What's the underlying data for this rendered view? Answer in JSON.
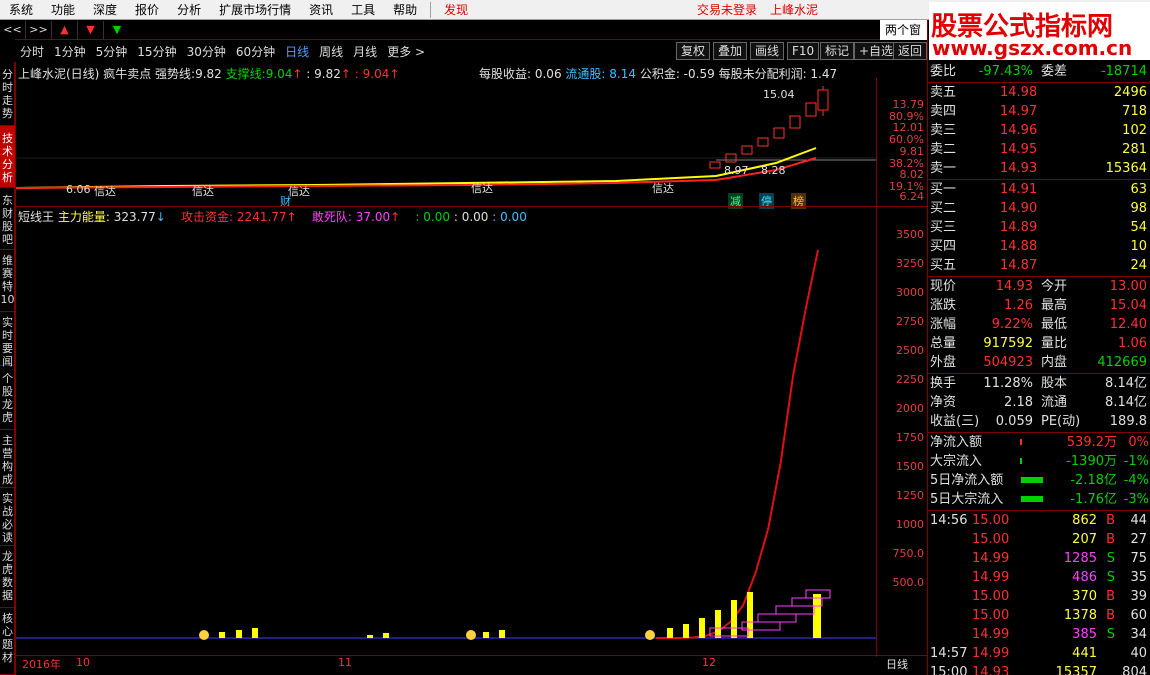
{
  "menu": {
    "items": [
      "系统",
      "功能",
      "深度",
      "报价",
      "分析",
      "扩展市场行情",
      "资讯",
      "工具",
      "帮助"
    ],
    "discover": "发现",
    "status": "交易未登录",
    "stock_name": "上峰水泥"
  },
  "nav": {
    "back": "<<",
    "fwd": ">>",
    "up": "▲",
    "down": "▼",
    "dd": "▼"
  },
  "periods": [
    "分时",
    "1分钟",
    "5分钟",
    "15分钟",
    "30分钟",
    "60分钟",
    "日线",
    "周线",
    "月线",
    "更多 >"
  ],
  "tools": [
    "复权",
    "叠加",
    "画线",
    "F10",
    "标记",
    "+自选",
    "返回"
  ],
  "window_tab": "两个窗",
  "left_tabs": [
    "分时走势",
    "技术分析",
    "东财股吧",
    "维赛特10",
    "实时要闻",
    "个股龙虎",
    "主营构成",
    "实战必读",
    "龙虎数据",
    "核心题材"
  ],
  "upper_legend": {
    "name": "上峰水泥(日线)",
    "indicator": "疯牛卖点",
    "strong_label": "强势线:",
    "strong_val": "9.82",
    "support_label": "支撑线:",
    "support_val": "9.04",
    "v3": ": 9.82",
    "v4": ": 9.04",
    "eps": "每股收益: 0.06",
    "float": "流通股: 8.14",
    "reserve": "公积金: -0.59",
    "undist": "每股未分配利润: 1.47"
  },
  "lower_legend": {
    "name": "短线王",
    "main_label": "主力能量:",
    "main_val": "323.77",
    "attack_label": "攻击资金:",
    "attack_val": "2241.77",
    "dare_label": "敢死队:",
    "dare_val": "37.00",
    "v4": ": 0.00",
    "v5": ": 0.00",
    "v6": ": 0.00"
  },
  "upper_axis": [
    "13.79",
    "80.9%",
    "12.01",
    "60.0%",
    "9.81",
    "38.2%",
    "8.02",
    "19.1%",
    "6.24"
  ],
  "upper_marks": {
    "high": "15.04",
    "p1": "8.97",
    "p2": "8.28",
    "low": "6.06"
  },
  "upper_labels": [
    "信达",
    "信达",
    "信达",
    "信达",
    "信达"
  ],
  "badges": [
    "财",
    "减",
    "停",
    "榜"
  ],
  "lower_axis": [
    "3500",
    "3250",
    "3000",
    "2750",
    "2500",
    "2250",
    "2000",
    "1750",
    "1500",
    "1250",
    "1000",
    "750.0",
    "500.0"
  ],
  "x_axis": {
    "year": "2016年",
    "m10": "10",
    "m11": "11",
    "m12": "12",
    "period": "日线"
  },
  "chart_data": {
    "type": "line",
    "series": [
      {
        "name": "攻击资金",
        "values": [
          0,
          0,
          0,
          5,
          20,
          60,
          150,
          300,
          600,
          1000,
          1600,
          2400,
          3000,
          3550
        ]
      },
      {
        "name": "主力能量",
        "values": [
          0,
          0,
          0,
          0,
          10,
          30,
          60,
          120,
          200,
          323.77
        ]
      }
    ]
  },
  "logo": {
    "line1": "股票公式指标网",
    "line2": "www.gszx.com.cn"
  },
  "quote": {
    "weibi_label": "委比",
    "weibi_val": "-97.43%",
    "weicha_label": "委差",
    "weicha_val": "-18714",
    "asks": [
      {
        "label": "卖五",
        "price": "14.98",
        "vol": "2496"
      },
      {
        "label": "卖四",
        "price": "14.97",
        "vol": "718"
      },
      {
        "label": "卖三",
        "price": "14.96",
        "vol": "102"
      },
      {
        "label": "卖二",
        "price": "14.95",
        "vol": "281"
      },
      {
        "label": "卖一",
        "price": "14.93",
        "vol": "15364"
      }
    ],
    "bids": [
      {
        "label": "买一",
        "price": "14.91",
        "vol": "63"
      },
      {
        "label": "买二",
        "price": "14.90",
        "vol": "98"
      },
      {
        "label": "买三",
        "price": "14.89",
        "vol": "54"
      },
      {
        "label": "买四",
        "price": "14.88",
        "vol": "10"
      },
      {
        "label": "买五",
        "price": "14.87",
        "vol": "24"
      }
    ],
    "stats": [
      {
        "l1": "现价",
        "v1": "14.93",
        "c1": "red",
        "l2": "今开",
        "v2": "13.00",
        "c2": "red"
      },
      {
        "l1": "涨跌",
        "v1": "1.26",
        "c1": "red",
        "l2": "最高",
        "v2": "15.04",
        "c2": "red"
      },
      {
        "l1": "涨幅",
        "v1": "9.22%",
        "c1": "red",
        "l2": "最低",
        "v2": "12.40",
        "c2": "red"
      },
      {
        "l1": "总量",
        "v1": "917592",
        "c1": "yellow",
        "l2": "量比",
        "v2": "1.06",
        "c2": "red"
      },
      {
        "l1": "外盘",
        "v1": "504923",
        "c1": "red",
        "l2": "内盘",
        "v2": "412669",
        "c2": "green"
      }
    ],
    "stats2": [
      {
        "l1": "换手",
        "v1": "11.28%",
        "l2": "股本",
        "v2": "8.14亿"
      },
      {
        "l1": "净资",
        "v1": "2.18",
        "l2": "流通",
        "v2": "8.14亿"
      },
      {
        "l1": "收益(三)",
        "v1": "0.059",
        "l2": "PE(动)",
        "v2": "189.8"
      }
    ],
    "flows": [
      {
        "label": "净流入额",
        "val": "539.2万",
        "pct": "0%",
        "c": "red"
      },
      {
        "label": "大宗流入",
        "val": "-1390万",
        "pct": "-1%",
        "c": "green"
      },
      {
        "label": "5日净流入额",
        "val": "-2.18亿",
        "pct": "-4%",
        "c": "green"
      },
      {
        "label": "5日大宗流入",
        "val": "-1.76亿",
        "pct": "-3%",
        "c": "green"
      }
    ],
    "ticks": [
      {
        "t": "14:56",
        "p": "15.00",
        "v": "862",
        "bs": "B",
        "n": "44"
      },
      {
        "t": "",
        "p": "15.00",
        "v": "207",
        "bs": "B",
        "n": "27"
      },
      {
        "t": "",
        "p": "14.99",
        "v": "1285",
        "bs": "S",
        "n": "75"
      },
      {
        "t": "",
        "p": "14.99",
        "v": "486",
        "bs": "S",
        "n": "35"
      },
      {
        "t": "",
        "p": "15.00",
        "v": "370",
        "bs": "B",
        "n": "39"
      },
      {
        "t": "",
        "p": "15.00",
        "v": "1378",
        "bs": "B",
        "n": "60"
      },
      {
        "t": "",
        "p": "14.99",
        "v": "385",
        "bs": "S",
        "n": "34"
      },
      {
        "t": "14:57",
        "p": "14.99",
        "v": "441",
        "bs": "",
        "n": "40"
      },
      {
        "t": "15:00",
        "p": "14.93",
        "v": "15357",
        "bs": "",
        "n": "804"
      }
    ]
  }
}
